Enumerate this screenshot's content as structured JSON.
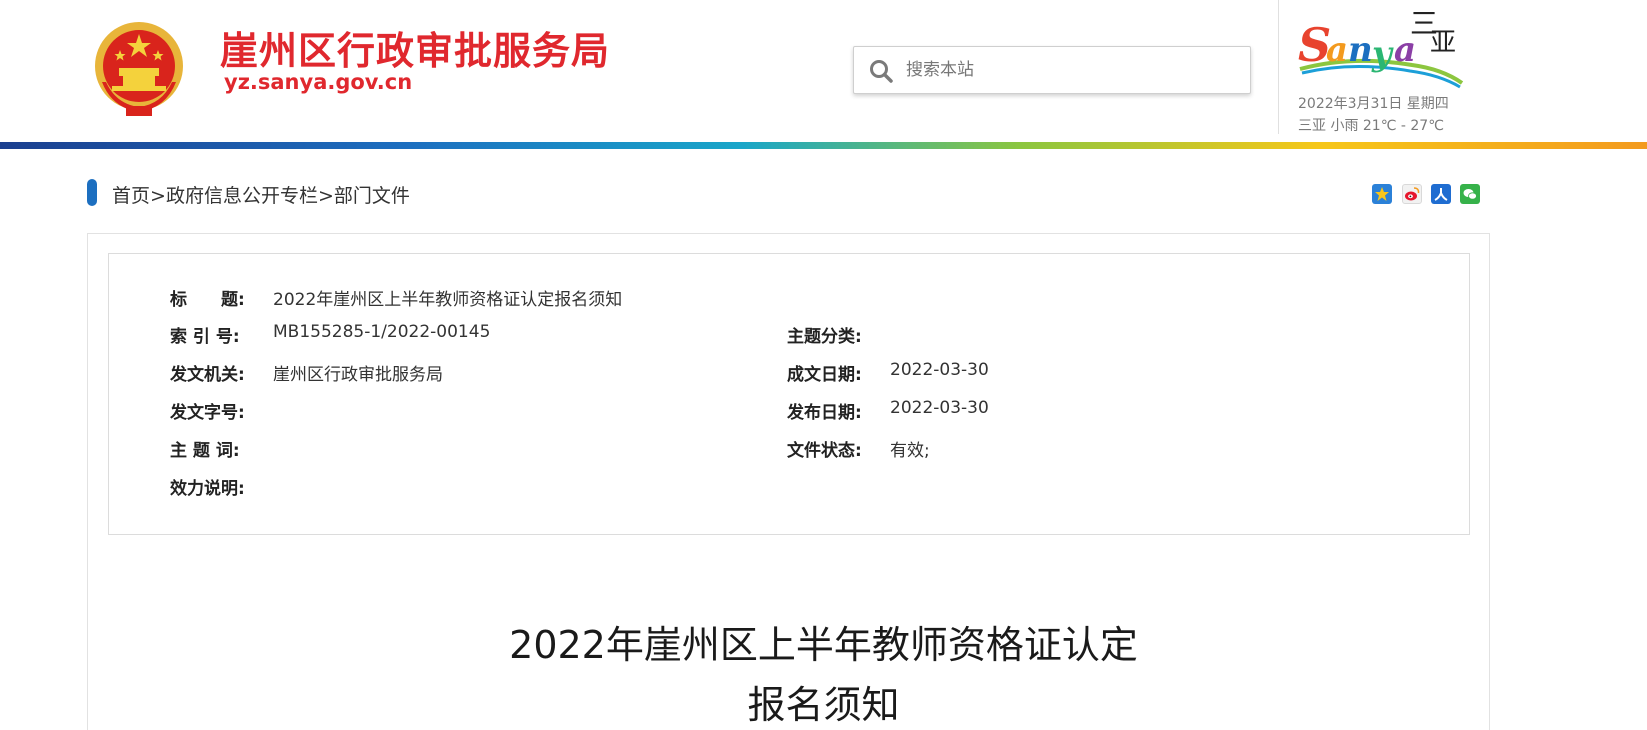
{
  "header": {
    "site_title": "崖州区行政审批服务局",
    "site_url": "yz.sanya.gov.cn",
    "search_placeholder": "搜索本站",
    "date": "2022年3月31日 星期四",
    "weather": "三亚  小雨  21℃ - 27℃",
    "logo_text": "Sanya",
    "logo_cn": "三亚"
  },
  "breadcrumb": {
    "items": [
      "首页",
      "政府信息公开专栏",
      "部门文件"
    ],
    "separator": ">"
  },
  "share_icons": [
    "qzone-icon",
    "weibo-icon",
    "renren-icon",
    "wechat-icon"
  ],
  "meta": {
    "title_label": "标　　题:",
    "title_value": "2022年崖州区上半年教师资格证认定报名须知",
    "index_label": "索 引 号:",
    "index_value": "MB155285-1/2022-00145",
    "subject_label": "主题分类:",
    "subject_value": "",
    "issuer_label": "发文机关:",
    "issuer_value": "崖州区行政审批服务局",
    "written_label": "成文日期:",
    "written_value": "2022-03-30",
    "docno_label": "发文字号:",
    "docno_value": "",
    "published_label": "发布日期:",
    "published_value": "2022-03-30",
    "keywords_label": "主 题 词:",
    "keywords_value": "",
    "status_label": "文件状态:",
    "status_value": "有效;",
    "validity_label": "效力说明:",
    "validity_value": ""
  },
  "document": {
    "title_line1": "2022年崖州区上半年教师资格证认定",
    "title_line2": "报名须知"
  },
  "colors": {
    "brand_red": "#e0282e",
    "accent_blue": "#1c6fc0"
  }
}
